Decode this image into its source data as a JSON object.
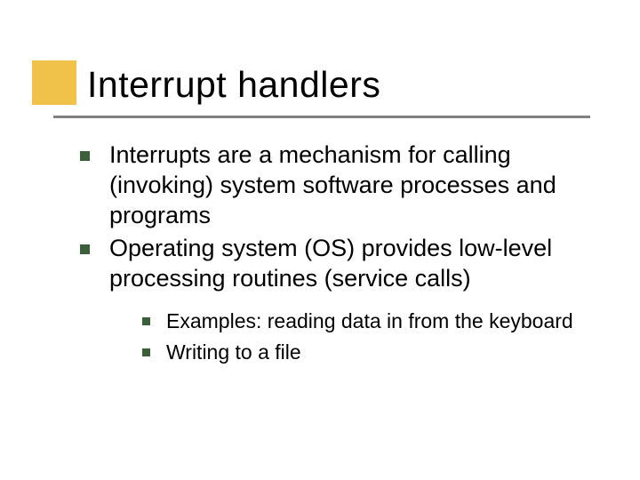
{
  "slide": {
    "title": "Interrupt handlers",
    "bullets": [
      {
        "text": "Interrupts are a mechanism for calling (invoking) system software processes and programs"
      },
      {
        "text": "Operating system (OS) provides low-level processing routines (service calls)",
        "sub": [
          {
            "text": "Examples: reading data in from the keyboard"
          },
          {
            "text": "Writing to a file"
          }
        ]
      }
    ]
  }
}
